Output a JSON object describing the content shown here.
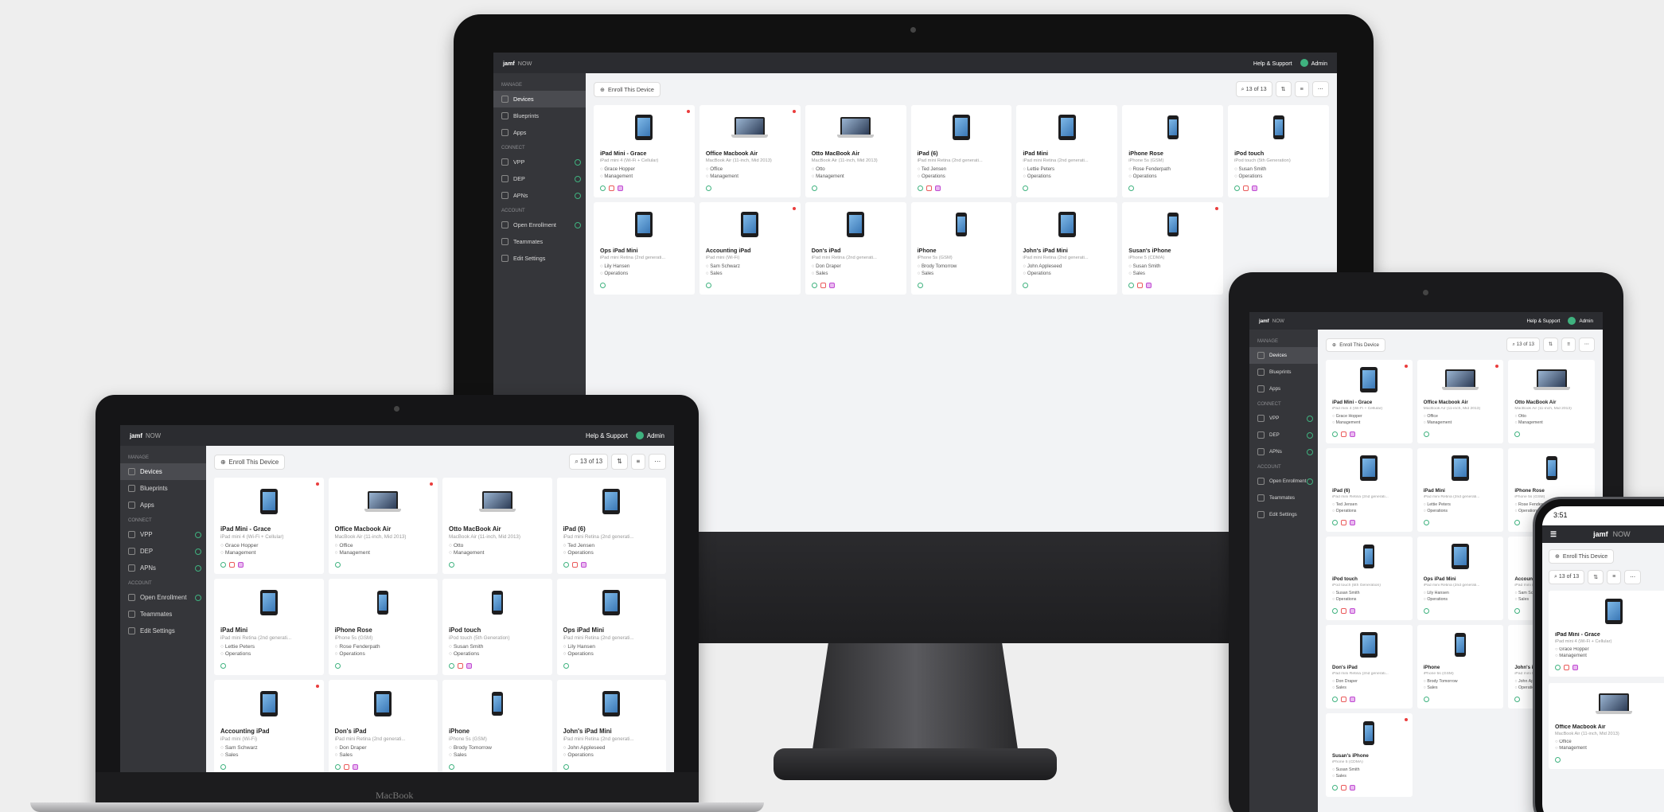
{
  "app": {
    "brand": "jamf",
    "brand_suffix": "NOW",
    "help": "Help & Support",
    "admin": "Admin",
    "enroll": "Enroll This Device",
    "count": "13 of 13",
    "tool_sort": "⇅",
    "tool_filter": "≡",
    "tool_more": "⋯"
  },
  "sidebar": {
    "manage": "MANAGE",
    "connect": "CONNECT",
    "account": "ACCOUNT",
    "items": [
      {
        "label": "Devices"
      },
      {
        "label": "Blueprints"
      },
      {
        "label": "Apps"
      },
      {
        "label": "VPP"
      },
      {
        "label": "DEP"
      },
      {
        "label": "APNs"
      },
      {
        "label": "Open Enrollment"
      },
      {
        "label": "Teammates"
      },
      {
        "label": "Edit Settings"
      }
    ]
  },
  "devices": [
    {
      "name": "iPad Mini - Grace",
      "model": "iPad mini 4 (Wi-Fi + Cellular)",
      "user": "Grace Hopper",
      "group": "Management",
      "type": "ipad",
      "alert": true
    },
    {
      "name": "Office Macbook Air",
      "model": "MacBook Air (11-inch, Mid 2013)",
      "user": "Office",
      "group": "Management",
      "type": "mac",
      "alert": true
    },
    {
      "name": "Otto MacBook Air",
      "model": "MacBook Air (11-inch, Mid 2013)",
      "user": "Otto",
      "group": "Management",
      "type": "mac",
      "alert": false
    },
    {
      "name": "iPad (6)",
      "model": "iPad mini Retina (2nd generati...",
      "user": "Ted Jensen",
      "group": "Operations",
      "type": "ipad",
      "alert": false
    },
    {
      "name": "iPad Mini",
      "model": "iPad mini Retina (2nd generati...",
      "user": "Lettie Peters",
      "group": "Operations",
      "type": "ipad",
      "alert": false
    },
    {
      "name": "iPhone Rose",
      "model": "iPhone 5s (GSM)",
      "user": "Rose Fenderpath",
      "group": "Operations",
      "type": "phone",
      "alert": false
    },
    {
      "name": "iPod touch",
      "model": "iPod touch (5th Generation)",
      "user": "Susan Smith",
      "group": "Operations",
      "type": "phone",
      "alert": false
    },
    {
      "name": "Ops iPad Mini",
      "model": "iPad mini Retina (2nd generati...",
      "user": "Lily Hansen",
      "group": "Operations",
      "type": "ipad",
      "alert": false
    },
    {
      "name": "Accounting iPad",
      "model": "iPad mini (Wi-Fi)",
      "user": "Sam Schwarz",
      "group": "Sales",
      "type": "ipad",
      "alert": true
    },
    {
      "name": "Don's iPad",
      "model": "iPad mini Retina (2nd generati...",
      "user": "Don Draper",
      "group": "Sales",
      "type": "ipad",
      "alert": false
    },
    {
      "name": "iPhone",
      "model": "iPhone 5s (GSM)",
      "user": "Brody Tomorrow",
      "group": "Sales",
      "type": "phone",
      "alert": false
    },
    {
      "name": "John's iPad Mini",
      "model": "iPad mini Retina (2nd generati...",
      "user": "John Appleseed",
      "group": "Operations",
      "type": "ipad",
      "alert": false
    },
    {
      "name": "Susan's iPhone",
      "model": "iPhone 5 (CDMA)",
      "user": "Susan Smith",
      "group": "Sales",
      "type": "phone",
      "alert": true
    }
  ],
  "laptop_label": "MacBook",
  "phone_status": "3:51"
}
